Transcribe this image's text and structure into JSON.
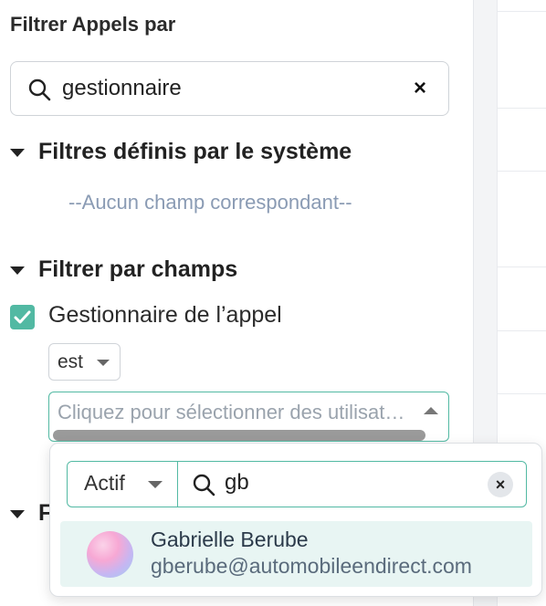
{
  "filter_panel": {
    "title": "Filtrer Appels par",
    "search": {
      "value": "gestionnaire",
      "clear_icon": "close-icon",
      "search_icon": "search-icon"
    },
    "system_filters": {
      "label": "Filtres définis par le système",
      "empty_message": "--Aucun champ correspondant--"
    },
    "field_filters": {
      "label": "Filtrer par champs",
      "field": {
        "checked": true,
        "label": "Gestionnaire de l’appel",
        "operator": "est",
        "user_select_placeholder": "Cliquez pour sélectionner des utilisateurs"
      }
    },
    "partially_hidden_section_letter": "F"
  },
  "user_dropdown": {
    "status_filter": "Actif",
    "query": "gb",
    "results": [
      {
        "name": "Gabrielle Berube",
        "email": "gberube@automobileendirect.com"
      }
    ]
  },
  "colors": {
    "accent": "#52b9a3",
    "muted_text": "#8a9bb4",
    "result_highlight": "#e8f5f3"
  }
}
